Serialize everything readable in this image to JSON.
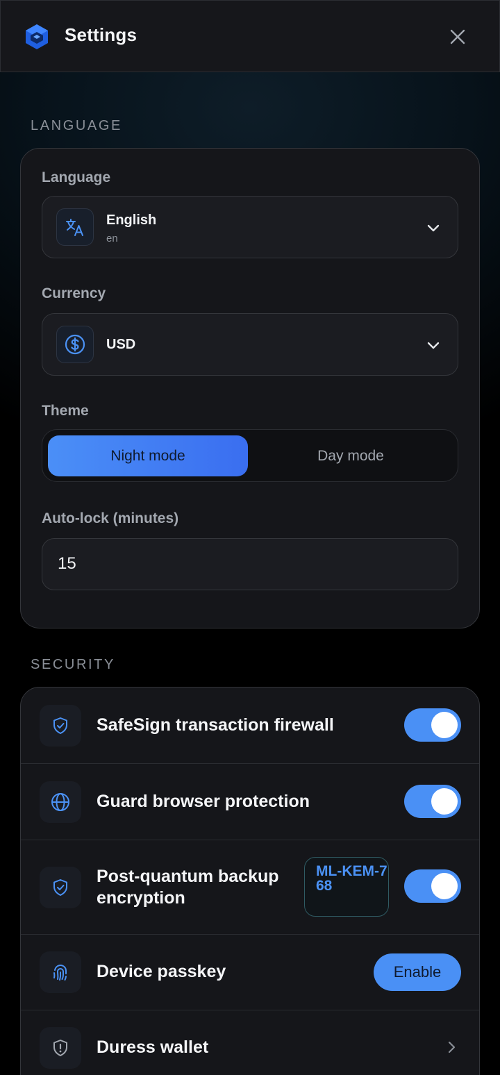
{
  "header": {
    "title": "Settings",
    "logo_icon": "hexagon-logo-icon",
    "close_icon": "close-icon"
  },
  "sections": {
    "language_label": "LANGUAGE",
    "security_label": "SECURITY"
  },
  "language_card": {
    "language": {
      "label": "Language",
      "selected": "English",
      "selected_code": "en",
      "icon": "translate-icon"
    },
    "currency": {
      "label": "Currency",
      "selected": "USD",
      "icon": "dollar-circle-icon"
    },
    "theme": {
      "label": "Theme",
      "options": [
        "Night mode",
        "Day mode"
      ],
      "selected": "Night mode"
    },
    "autolock": {
      "label": "Auto-lock (minutes)",
      "value": "15"
    }
  },
  "security": {
    "items": [
      {
        "label": "SafeSign transaction firewall",
        "icon": "shield-check-icon",
        "control": "toggle",
        "on": true
      },
      {
        "label": "Guard browser protection",
        "icon": "globe-icon",
        "control": "toggle",
        "on": true
      },
      {
        "label_line1": "Post-quantum backup",
        "label_line2": "encryption",
        "icon": "shield-check-icon",
        "badge": "ML-KEM-768",
        "control": "toggle",
        "on": true
      },
      {
        "label": "Device passkey",
        "icon": "fingerprint-icon",
        "control": "button",
        "button_label": "Enable"
      },
      {
        "label": "Duress wallet",
        "icon": "shield-alert-icon",
        "control": "chevron"
      }
    ]
  },
  "colors": {
    "accent": "#4a90f5",
    "card_bg": "#15161a",
    "header_bg": "#16171b"
  }
}
